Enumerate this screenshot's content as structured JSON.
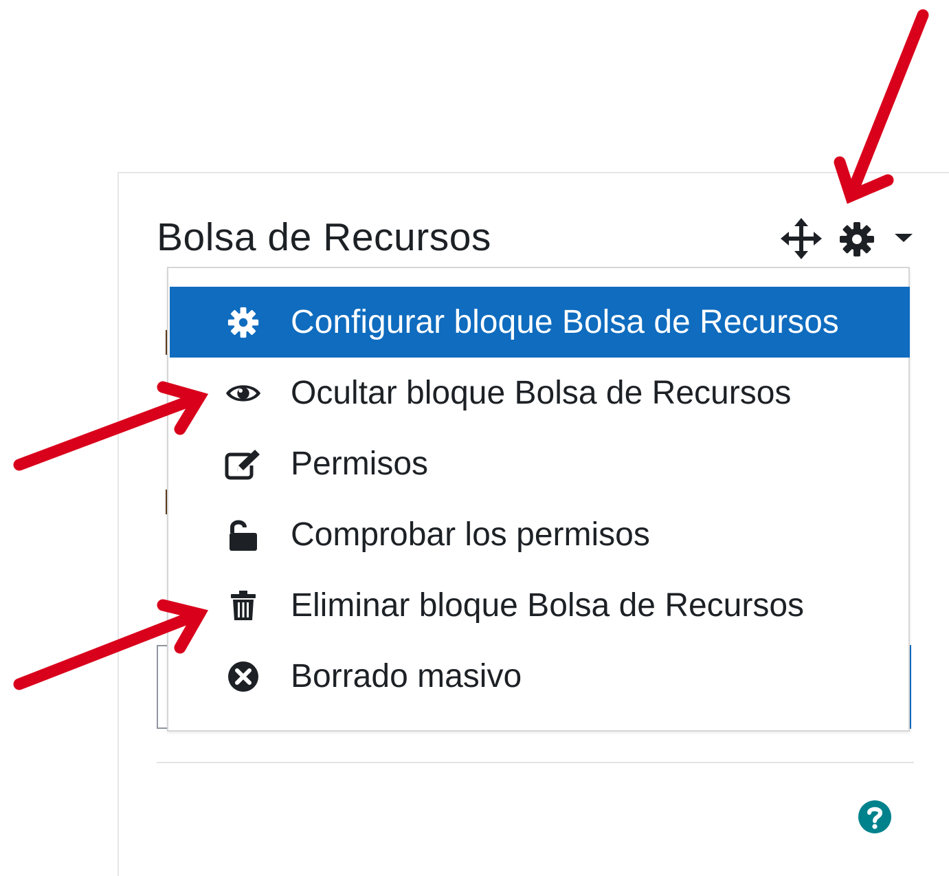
{
  "block": {
    "title": "Bolsa de Recursos"
  },
  "header_icons": {
    "move": "move-icon",
    "actions": "gear-icon",
    "toggle": "caret-down-icon"
  },
  "menu": {
    "items": [
      {
        "label": "Configurar bloque Bolsa de Recursos",
        "icon": "gear-icon",
        "active": true
      },
      {
        "label": "Ocultar bloque Bolsa de Recursos",
        "icon": "eye-icon",
        "active": false
      },
      {
        "label": "Permisos",
        "icon": "edit-icon",
        "active": false
      },
      {
        "label": "Comprobar los permisos",
        "icon": "unlock-icon",
        "active": false
      },
      {
        "label": "Eliminar bloque Bolsa de Recursos",
        "icon": "trash-icon",
        "active": false
      },
      {
        "label": "Borrado masivo",
        "icon": "times-circle-icon",
        "active": false
      }
    ]
  },
  "footer": {
    "help_icon": "question-circle-icon"
  },
  "colors": {
    "active_bg": "#0f6cbf",
    "text": "#1d2125",
    "arrow": "#d9001b",
    "help": "#00828c"
  }
}
